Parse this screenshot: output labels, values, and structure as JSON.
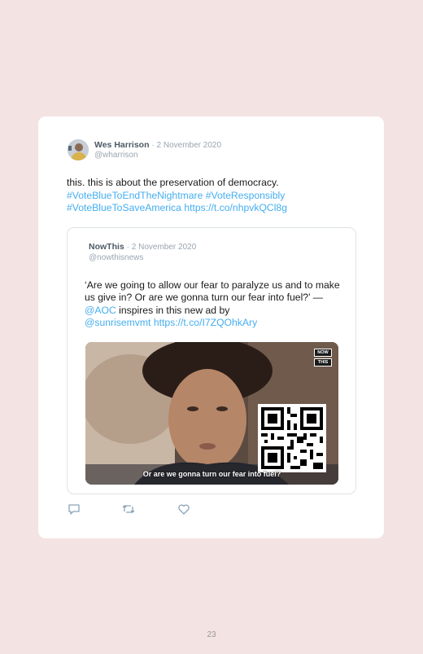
{
  "tweet": {
    "author": "Wes Harrison",
    "date": "· 2 November 2020",
    "handle": "@wharrison",
    "text_plain": "this. this is about the preservation of democracy.",
    "hashtag_1": "#VoteBlueToEndTheNightmare",
    "hashtag_2": "#VoteResponsibly",
    "hashtag_3": "#VoteBlueToSaveAmerica",
    "link": "https://t.co/nhpvkQCl8g"
  },
  "quoted_tweet": {
    "author": "NowThis",
    "date": "· 2 November 2020",
    "handle": "@nowthisnews",
    "text_1": "‘Are we going to allow our fear to paralyze us and to make us give in? Or are we gonna turn our fear into fuel?’ — ",
    "mention_1": "@AOC",
    "text_2": " inspires in this new ad by ",
    "mention_2": "@sunrisemvmt",
    "link": "https://t.co/I7ZQOhkAry",
    "video": {
      "logo_line_1": "NOW",
      "logo_line_2": "THIS",
      "caption": "Or are we gonna turn our fear into fuel?"
    }
  },
  "actions": {
    "reply_icon": "reply-icon",
    "retweet_icon": "retweet-icon",
    "like_icon": "heart-icon"
  },
  "page_number": "23",
  "colors": {
    "background": "#f4e3e3",
    "link": "#45aef0",
    "card": "#ffffff"
  }
}
